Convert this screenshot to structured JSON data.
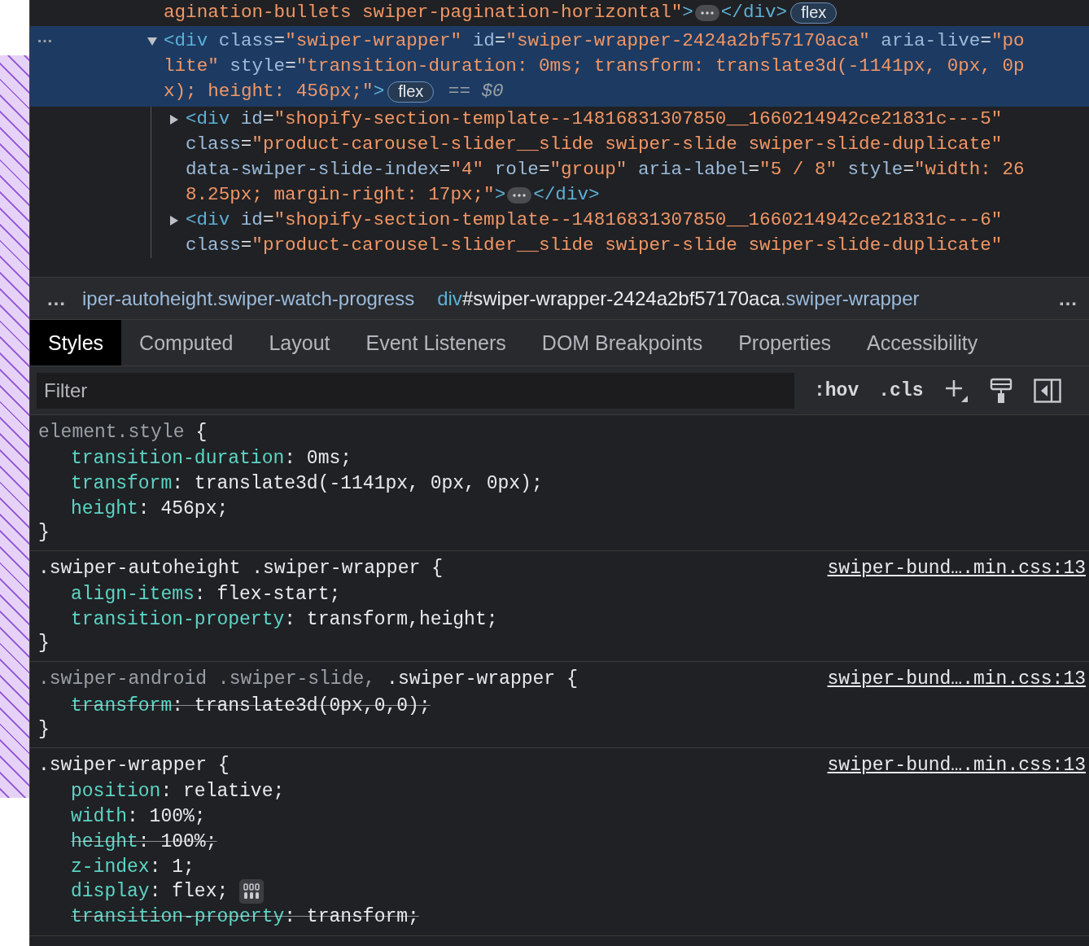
{
  "elements": {
    "nodes": [
      {
        "lines": [
          [
            {
              "kind": "value",
              "text": "agination-bullets swiper-pagination-horizontal\""
            },
            {
              "kind": "tag",
              "text": ">"
            },
            {
              "kind": "more"
            },
            {
              "kind": "tag",
              "text": "</div>"
            },
            {
              "kind": "badge",
              "text": "flex"
            }
          ]
        ]
      },
      {
        "selected": true,
        "expanded": true,
        "gutter": "…",
        "lines": [
          [
            {
              "kind": "tag",
              "text": "<div"
            },
            {
              "kind": "attr",
              "text": " class"
            },
            {
              "kind": "plain",
              "text": "="
            },
            {
              "kind": "value",
              "text": "\"swiper-wrapper\""
            },
            {
              "kind": "attr",
              "text": " id"
            },
            {
              "kind": "plain",
              "text": "="
            },
            {
              "kind": "value",
              "text": "\"swiper-wrapper-2424a2bf57170aca\""
            },
            {
              "kind": "attr",
              "text": " aria-live"
            },
            {
              "kind": "plain",
              "text": "="
            },
            {
              "kind": "value",
              "text": "\"po"
            }
          ],
          [
            {
              "kind": "value",
              "text": "lite\""
            },
            {
              "kind": "attr",
              "text": " style"
            },
            {
              "kind": "plain",
              "text": "="
            },
            {
              "kind": "value",
              "text": "\"transition-duration: 0ms; transform: translate3d(-1141px, 0px, 0p"
            }
          ],
          [
            {
              "kind": "value",
              "text": "x); height: 456px;\""
            },
            {
              "kind": "tag",
              "text": ">"
            },
            {
              "kind": "badge",
              "text": "flex"
            },
            {
              "kind": "dim",
              "text": " == "
            },
            {
              "kind": "dollar",
              "text": "$0"
            }
          ]
        ],
        "children": [
          {
            "selected": false,
            "expanded": false,
            "lines": [
              [
                {
                  "kind": "tag",
                  "text": "<div"
                },
                {
                  "kind": "attr",
                  "text": " id"
                },
                {
                  "kind": "plain",
                  "text": "="
                },
                {
                  "kind": "value",
                  "text": "\"shopify-section-template--14816831307850__1660214942ce21831c---5\""
                }
              ],
              [
                {
                  "kind": "attr",
                  "text": "class"
                },
                {
                  "kind": "plain",
                  "text": "="
                },
                {
                  "kind": "value",
                  "text": "\"product-carousel-slider__slide swiper-slide swiper-slide-duplicate\""
                }
              ],
              [
                {
                  "kind": "attr",
                  "text": "data-swiper-slide-index"
                },
                {
                  "kind": "plain",
                  "text": "="
                },
                {
                  "kind": "value",
                  "text": "\"4\""
                },
                {
                  "kind": "attr",
                  "text": " role"
                },
                {
                  "kind": "plain",
                  "text": "="
                },
                {
                  "kind": "value",
                  "text": "\"group\""
                },
                {
                  "kind": "attr",
                  "text": " aria-label"
                },
                {
                  "kind": "plain",
                  "text": "="
                },
                {
                  "kind": "value",
                  "text": "\"5 / 8\""
                },
                {
                  "kind": "attr",
                  "text": " style"
                },
                {
                  "kind": "plain",
                  "text": "="
                },
                {
                  "kind": "value",
                  "text": "\"width: 26"
                }
              ],
              [
                {
                  "kind": "value",
                  "text": "8.25px; margin-right: 17px;\""
                },
                {
                  "kind": "tag",
                  "text": ">"
                },
                {
                  "kind": "more"
                },
                {
                  "kind": "tag",
                  "text": "</div>"
                }
              ]
            ]
          },
          {
            "selected": false,
            "expanded": false,
            "lines": [
              [
                {
                  "kind": "tag",
                  "text": "<div"
                },
                {
                  "kind": "attr",
                  "text": " id"
                },
                {
                  "kind": "plain",
                  "text": "="
                },
                {
                  "kind": "value",
                  "text": "\"shopify-section-template--14816831307850__1660214942ce21831c---6\""
                }
              ],
              [
                {
                  "kind": "attr",
                  "text": "class"
                },
                {
                  "kind": "plain",
                  "text": "="
                },
                {
                  "kind": "value",
                  "text": "\"product-carousel-slider__slide swiper-slide swiper-slide-duplicate\""
                }
              ]
            ]
          }
        ]
      }
    ]
  },
  "breadcrumbs": {
    "overflow_left": "…",
    "overflow_right": "…",
    "items": [
      {
        "parts": [
          {
            "kind": "class",
            "text": "iper-autoheight.swiper-watch-progress"
          }
        ]
      },
      {
        "parts": [
          {
            "kind": "tag",
            "text": "div"
          },
          {
            "kind": "id",
            "text": "#swiper-wrapper-2424a2bf57170aca"
          },
          {
            "kind": "class",
            "text": ".swiper-wrapper"
          }
        ]
      }
    ]
  },
  "tabs": [
    {
      "label": "Styles",
      "selected": true
    },
    {
      "label": "Computed",
      "selected": false
    },
    {
      "label": "Layout",
      "selected": false
    },
    {
      "label": "Event Listeners",
      "selected": false
    },
    {
      "label": "DOM Breakpoints",
      "selected": false
    },
    {
      "label": "Properties",
      "selected": false
    },
    {
      "label": "Accessibility",
      "selected": false
    }
  ],
  "filter": {
    "placeholder": "Filter",
    "hov": ":hov",
    "cls": ".cls"
  },
  "rules": [
    {
      "selector": [
        {
          "text": "element.style",
          "matched": false
        }
      ],
      "open": "{",
      "close": "}",
      "declarations": [
        {
          "name": "transition-duration",
          "value": ": 0ms;",
          "overridden": false
        },
        {
          "name": "transform",
          "value": ": translate3d(-1141px, 0px, 0px);",
          "overridden": false
        },
        {
          "name": "height",
          "value": ": 456px;",
          "overridden": false
        }
      ]
    },
    {
      "selector": [
        {
          "text": ".swiper-autoheight .swiper-wrapper",
          "matched": true
        }
      ],
      "open": "{",
      "close": "}",
      "source": "swiper-bund….min.css:13",
      "declarations": [
        {
          "name": "align-items",
          "value": ": flex-start;",
          "overridden": false
        },
        {
          "name": "transition-property",
          "value": ": transform,height;",
          "overridden": false
        }
      ]
    },
    {
      "selector": [
        {
          "text": ".swiper-android .swiper-slide,",
          "matched": false
        },
        {
          "text": ".swiper-wrapper",
          "matched": true
        }
      ],
      "open": "{",
      "close": "}",
      "source": "swiper-bund….min.css:13",
      "declarations": [
        {
          "name": "transform",
          "value": ": translate3d(0px,0,0);",
          "overridden": true
        }
      ]
    },
    {
      "selector": [
        {
          "text": ".swiper-wrapper",
          "matched": true
        }
      ],
      "open": "{",
      "source": "swiper-bund….min.css:13",
      "declarations": [
        {
          "name": "position",
          "value": ": relative;",
          "overridden": false
        },
        {
          "name": "width",
          "value": ": 100%;",
          "overridden": false
        },
        {
          "name": "height",
          "value": ": 100%;",
          "overridden": true
        },
        {
          "name": "z-index",
          "value": ": 1;",
          "overridden": false
        },
        {
          "name": "display",
          "value": ": flex;",
          "overridden": false,
          "flex_editor": true
        },
        {
          "name": "transition-property",
          "value": ": transform;",
          "overridden": true
        }
      ]
    }
  ]
}
